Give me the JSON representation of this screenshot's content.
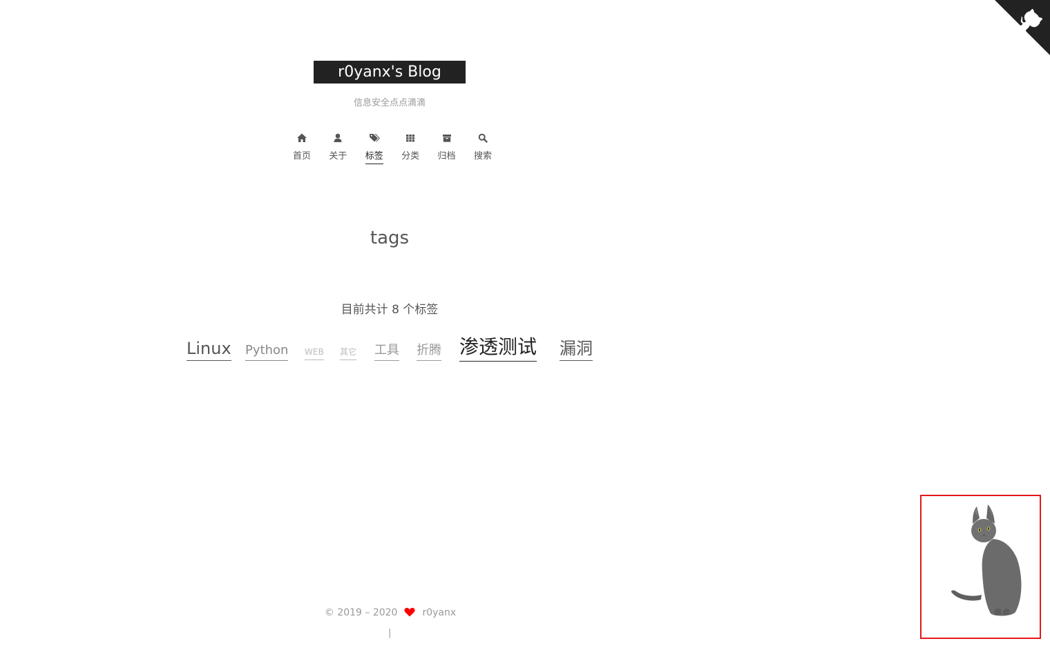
{
  "site": {
    "title": "r0yanx's Blog",
    "subtitle": "信息安全点点滴滴"
  },
  "menu": [
    {
      "label": "首页",
      "icon": "home-icon"
    },
    {
      "label": "关于",
      "icon": "user-icon"
    },
    {
      "label": "标签",
      "icon": "tags-icon",
      "active": true
    },
    {
      "label": "分类",
      "icon": "th-icon"
    },
    {
      "label": "归档",
      "icon": "archive-icon"
    },
    {
      "label": "搜索",
      "icon": "search-icon"
    }
  ],
  "page": {
    "title": "tags",
    "tag_count_text": "目前共计 8 个标签"
  },
  "tags": [
    {
      "name": "Linux",
      "color": "#555555"
    },
    {
      "name": "Python",
      "color": "#888888"
    },
    {
      "name": "WEB",
      "color": "#bbbbbb"
    },
    {
      "name": "其它",
      "color": "#bbbbbb"
    },
    {
      "name": "工具",
      "color": "#999999"
    },
    {
      "name": "折腾",
      "color": "#999999"
    },
    {
      "name": "渗透测试",
      "color": "#222222"
    },
    {
      "name": "漏洞",
      "color": "#555555"
    }
  ],
  "footer": {
    "copyright": "© 2019 – 2020",
    "author": "r0yanx",
    "separator": "|",
    "heart_color": "#ff0000"
  },
  "widget": {
    "border_color": "#e3161b",
    "cat_color": "#6b6b6b"
  }
}
